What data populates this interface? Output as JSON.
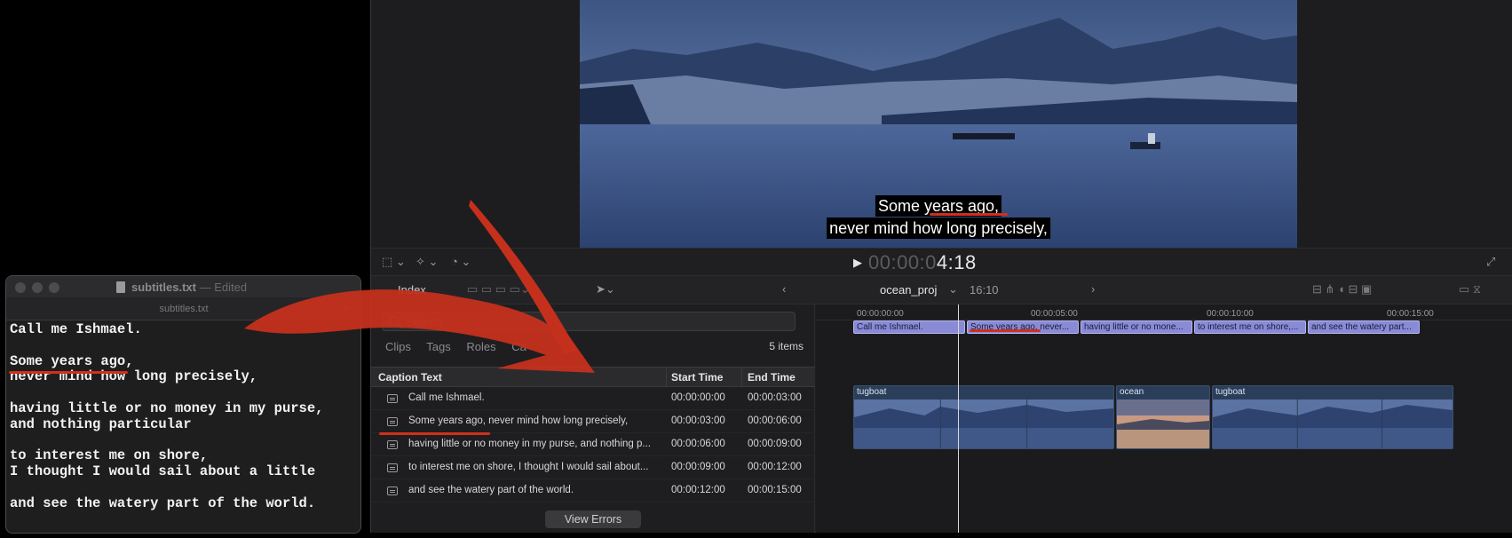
{
  "viewer": {
    "subtitle_line1": "Some years ago,",
    "subtitle_line2": "never mind how long precisely,",
    "timecode_dim": "00:00:0",
    "timecode_bright": "4:18"
  },
  "browser_bar": {
    "index_label": "Index",
    "project_name": "ocean_proj",
    "project_duration": "16:10"
  },
  "index_panel": {
    "search_placeholder": "Search",
    "filters": [
      "Clips",
      "Tags",
      "Roles",
      "Ca"
    ],
    "items_count": "5 items",
    "columns": [
      "Caption Text",
      "Start Time",
      "End Time"
    ],
    "rows": [
      {
        "text": "Call me Ishmael.",
        "start": "00:00:00:00",
        "end": "00:00:03:00"
      },
      {
        "text": "Some years ago, never mind how long precisely,",
        "start": "00:00:03:00",
        "end": "00:00:06:00"
      },
      {
        "text": "having little or no money in my purse, and nothing p...",
        "start": "00:00:06:00",
        "end": "00:00:09:00"
      },
      {
        "text": "to interest me on shore, I thought I would sail about...",
        "start": "00:00:09:00",
        "end": "00:00:12:00"
      },
      {
        "text": "and see the watery part of the world.",
        "start": "00:00:12:00",
        "end": "00:00:15:00"
      }
    ],
    "view_errors_label": "View Errors"
  },
  "timeline": {
    "ruler": [
      "00:00:00:00",
      "00:00:05:00",
      "00:00:10:00",
      "00:00:15:00"
    ],
    "captions": [
      "Call me Ishmael.",
      "Some years ago, never...",
      "having little or no mone...",
      "to interest me on shore,...",
      "and see the watery part..."
    ],
    "clips": [
      "tugboat",
      "ocean",
      "tugboat"
    ]
  },
  "editor": {
    "filename": "subtitles.txt",
    "status": "— Edited",
    "tab_label": "subtitles.txt",
    "add_tab": "+",
    "lines": [
      "Call me Ishmael.",
      "",
      "Some years ago,",
      "never mind how long precisely,",
      "",
      "having little or no money in my purse,",
      "and nothing particular",
      "",
      "to interest me on shore,",
      "I thought I would sail about a little",
      "",
      "and see the watery part of the world."
    ]
  },
  "colors": {
    "accent_red": "#d0301a",
    "caption_clip": "#8a8bd6"
  }
}
